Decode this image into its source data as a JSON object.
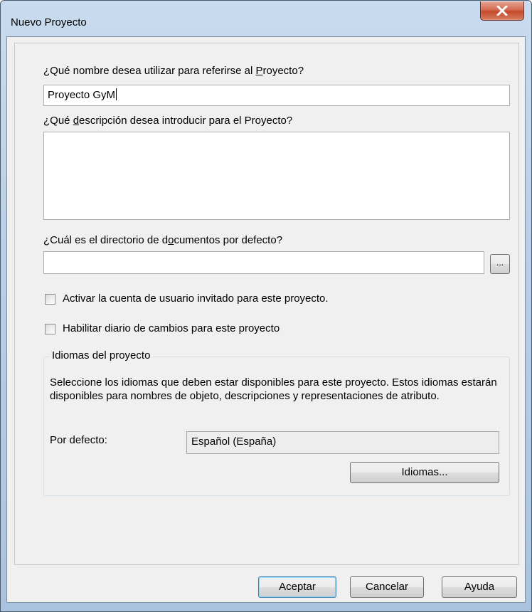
{
  "window": {
    "title": "Nuevo Proyecto",
    "close_label": "X"
  },
  "form": {
    "name_label_pre": "¿Qué nombre desea utilizar para referirse al ",
    "name_label_key": "P",
    "name_label_post": "royecto?",
    "name_value": "Proyecto GyM",
    "desc_label_pre": "¿Qué ",
    "desc_label_key": "d",
    "desc_label_post": "escripción desea introducir para el Proyecto?",
    "desc_value": "",
    "dir_label_pre": "¿Cuál es el directorio de d",
    "dir_label_key": "o",
    "dir_label_post": "cumentos por defecto?",
    "dir_value": "",
    "browse_label": "...",
    "guest_checkbox_label": "Activar la cuenta de usuario invitado para este proyecto.",
    "log_checkbox_label": "Habilitar diario de cambios para este proyecto"
  },
  "languages": {
    "group_title": "Idiomas del proyecto",
    "description": "Seleccione los idiomas que deben estar disponibles para este proyecto. Estos idiomas estarán disponibles para nombres de objeto, descripciones y representaciones de atributo.",
    "default_label": "Por defecto:",
    "default_value": "Español (España)",
    "languages_button": "Idiomas..."
  },
  "footer": {
    "accept": "Aceptar",
    "cancel": "Cancelar",
    "help": "Ayuda"
  }
}
